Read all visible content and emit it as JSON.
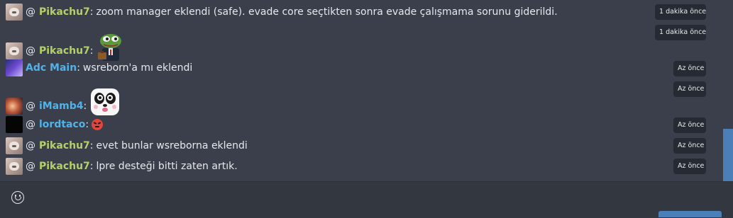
{
  "messages": [
    {
      "avatar": "pika",
      "user": "Pikachu7",
      "mention": true,
      "name_color": "green",
      "text": "zoom manager eklendi (safe). evade core seçtikten sonra evade çalışmama sorunu giderildi.",
      "timestamp": "1 dakika önce"
    },
    {
      "avatar": "pika",
      "user": "Pikachu7",
      "mention": true,
      "name_color": "green",
      "emote": "pepe-briefcase-emote",
      "timestamp": "1 dakika önce"
    },
    {
      "avatar": "adc",
      "user": "Adc Main",
      "mention": false,
      "name_color": "blue",
      "text": "wsreborn'a mı eklendi",
      "timestamp": "Az önce"
    },
    {
      "avatar": "imamb",
      "user": "iMamb4",
      "mention": true,
      "name_color": "blue",
      "emote": "panda-emote",
      "timestamp": "Az önce"
    },
    {
      "avatar": "lord",
      "user": "lordtaco",
      "mention": true,
      "name_color": "blue",
      "emote": "angry-face-emote",
      "timestamp": "Az önce"
    },
    {
      "avatar": "pika",
      "user": "Pikachu7",
      "mention": true,
      "name_color": "green",
      "text": "evet bunlar wsreborna eklendi",
      "timestamp": "Az önce"
    },
    {
      "avatar": "pika",
      "user": "Pikachu7",
      "mention": true,
      "name_color": "green",
      "text": "lpre desteği bitti zaten artık.",
      "timestamp": "Az önce"
    }
  ],
  "mention_symbol": "@",
  "colon": ":",
  "composer": {
    "emoji_icon": "smiley-icon"
  },
  "colors": {
    "background": "#3a3f4b",
    "green_name": "#b5d06a",
    "blue_name": "#4fb3ea",
    "timestamp_bg": "#262a33",
    "accent": "#4a7fb8"
  }
}
